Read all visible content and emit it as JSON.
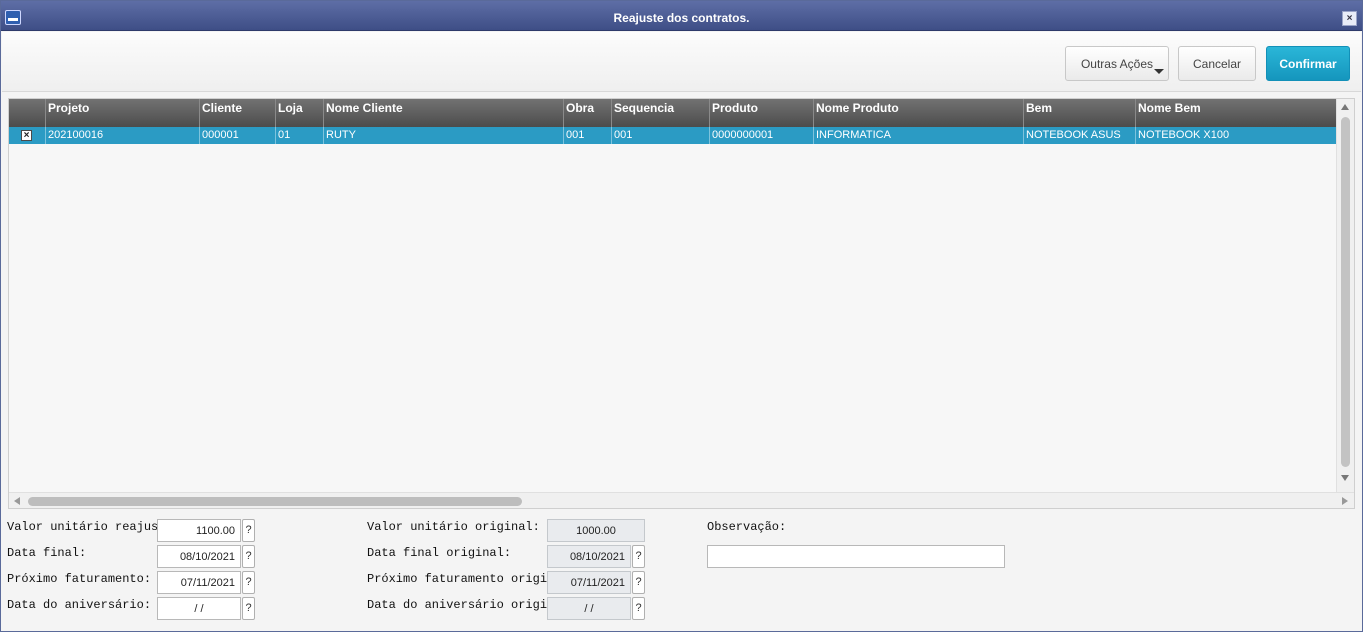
{
  "window": {
    "title": "Reajuste dos contratos."
  },
  "toolbar": {
    "outras_label": "Outras Ações",
    "cancelar_label": "Cancelar",
    "confirmar_label": "Confirmar"
  },
  "grid": {
    "columns": [
      "Projeto",
      "Cliente",
      "Loja",
      "Nome Cliente",
      "Obra",
      "Sequencia",
      "Produto",
      "Nome Produto",
      "Bem",
      "Nome Bem"
    ],
    "rows": [
      {
        "checked": "☒",
        "cells": [
          "202100016",
          "000001",
          "01",
          "RUTY",
          "001",
          "001",
          "0000000001",
          "INFORMATICA",
          "NOTEBOOK ASUS",
          "NOTEBOOK X100"
        ]
      }
    ]
  },
  "form": {
    "valor_reajuste_label": "Valor unitário reajuste:",
    "valor_reajuste": "1100.00",
    "data_final_label": "Data final:",
    "data_final": "08/10/2021",
    "proximo_label": "Próximo faturamento:",
    "proximo": "07/11/2021",
    "aniversario_label": "Data do aniversário:",
    "aniversario": " / /",
    "valor_original_label": "Valor unitário original:",
    "valor_original": "1000.00",
    "data_final_original_label": "Data final original:",
    "data_final_original": "08/10/2021",
    "proximo_original_label": "Próximo faturamento original:",
    "proximo_original": "07/11/2021",
    "aniversario_original_label": "Data do aniversário original:",
    "aniversario_original": " / /",
    "observacao_label": "Observação:",
    "observacao": "",
    "help_glyph": "?"
  }
}
